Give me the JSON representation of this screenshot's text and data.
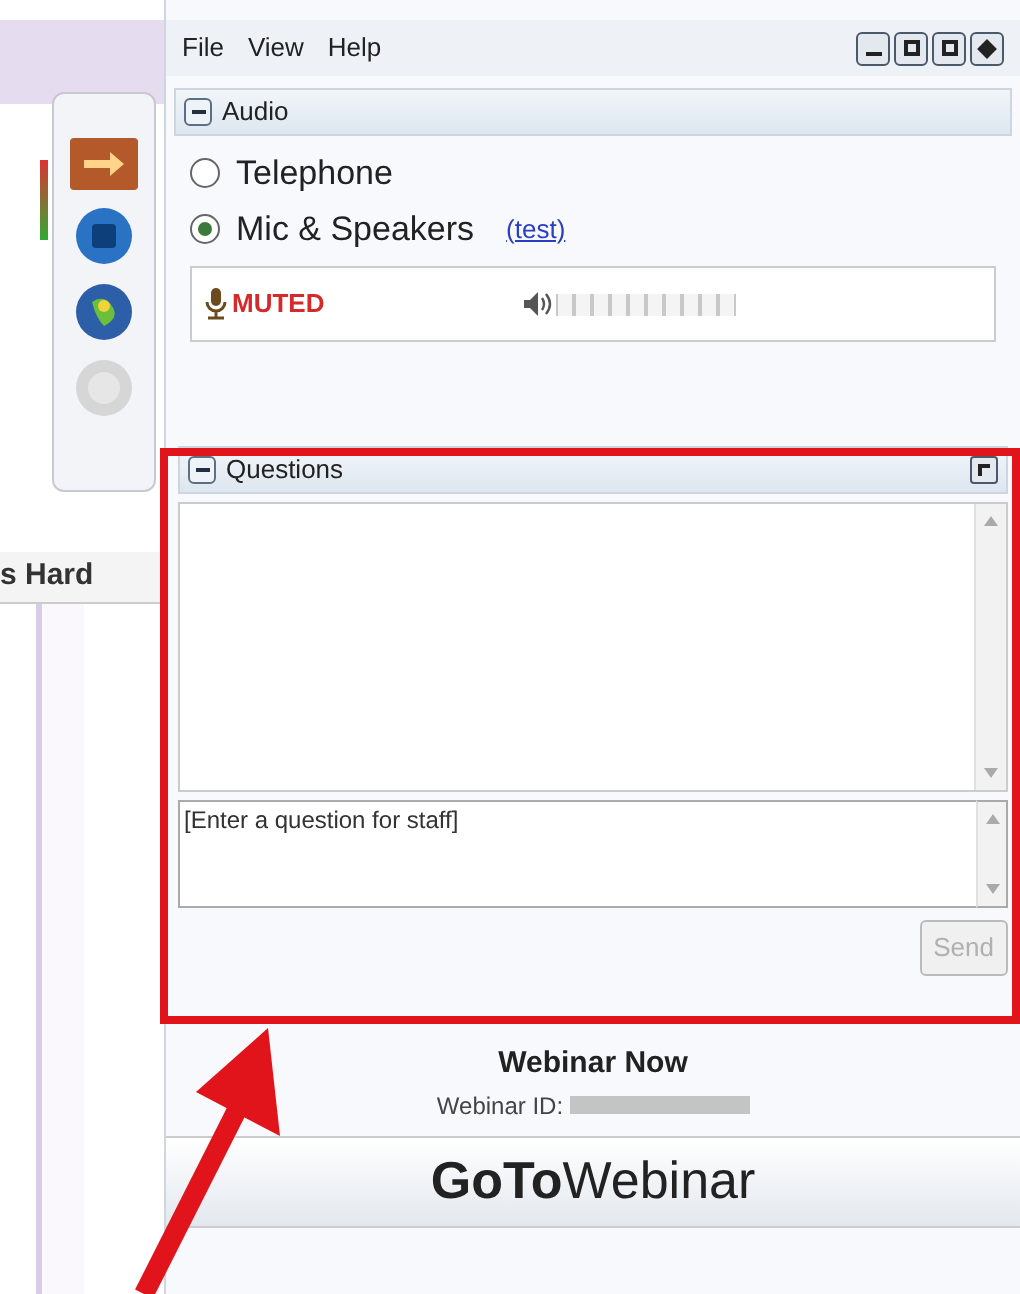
{
  "side_tab": {
    "label": "s Hard"
  },
  "menu": [
    "File",
    "View",
    "Help"
  ],
  "audio": {
    "title": "Audio",
    "expanded": true,
    "options": [
      {
        "label": "Telephone",
        "selected": false
      },
      {
        "label": "Mic & Speakers",
        "selected": true
      }
    ],
    "test_link": "(test)",
    "mic_status": "MUTED",
    "speaker_meter": {
      "level": 0
    }
  },
  "questions": {
    "title": "Questions",
    "expanded": true,
    "placeholder": "[Enter a question for staff]",
    "send": "Send",
    "send_disabled": true
  },
  "footer": {
    "title": "Webinar Now",
    "id_label": "Webinar ID:",
    "logo": "**GoTo**Webinar"
  }
}
